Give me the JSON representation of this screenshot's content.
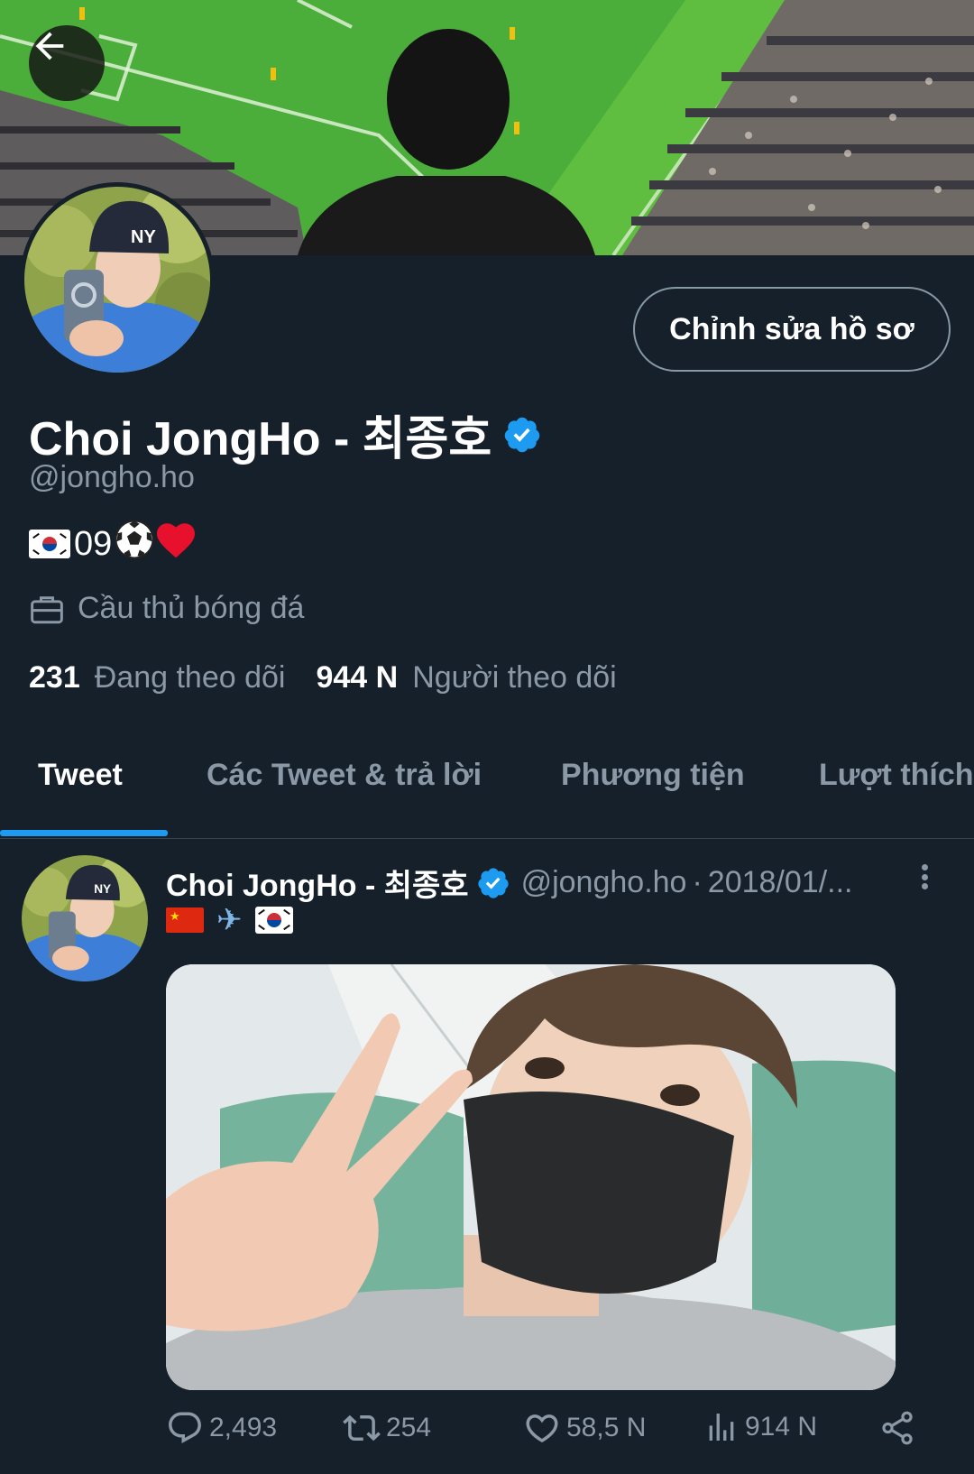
{
  "profile": {
    "edit_button": "Chỉnh sửa hồ sơ",
    "display_name": "Choi JongHo - 최종호",
    "handle": "@jongho.ho",
    "bio_number": "09",
    "job": "Cầu thủ bóng đá",
    "following_count": "231",
    "following_label": "Đang theo dõi",
    "followers_count": "944 N",
    "followers_label": "Người theo dõi"
  },
  "tabs": [
    {
      "label": "Tweet",
      "active": true
    },
    {
      "label": "Các Tweet & trả lời",
      "active": false
    },
    {
      "label": "Phương tiện",
      "active": false
    },
    {
      "label": "Lượt thích",
      "active": false
    }
  ],
  "tweet": {
    "author_name": "Choi JongHo - 최종호",
    "author_handle": "@jongho.ho",
    "separator": "·",
    "date": "2018/01/...",
    "replies": "2,493",
    "retweets": "254",
    "likes": "58,5 N",
    "views": "914 N"
  },
  "colors": {
    "background": "#15202b",
    "accent": "#1d9bf0",
    "muted_text": "#8b98a5",
    "verified": "#1d9bf0",
    "divider": "#38444d"
  },
  "icons": [
    "back-arrow-icon",
    "verified-badge-icon",
    "briefcase-icon",
    "more-vertical-icon",
    "reply-icon",
    "retweet-icon",
    "like-icon",
    "views-icon",
    "share-icon"
  ]
}
